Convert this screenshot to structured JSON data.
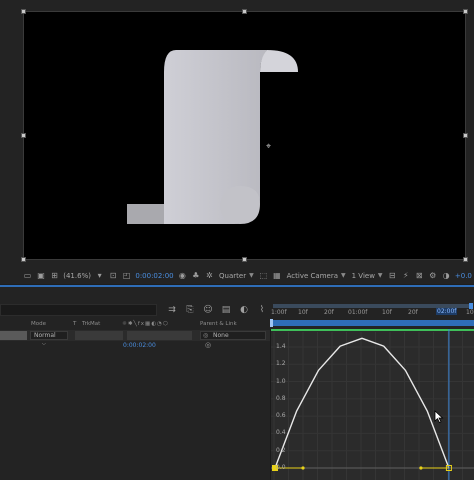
{
  "viewer": {
    "toolbar": {
      "zoom": "(41.6%)",
      "timecode": "0:00:02:00",
      "resolution": "Quarter",
      "camera": "Active Camera",
      "views": "1 View",
      "exposure": "+0.0"
    }
  },
  "timeline": {
    "columns": {
      "mode": "Mode",
      "t": "T",
      "trkmat": "TrkMat",
      "parent": "Parent & Link"
    },
    "layer": {
      "mode": "Normal",
      "parent": "None"
    },
    "property_time": "0:00:02:00",
    "ruler": {
      "ticks": [
        "1:00f",
        "10f",
        "20f",
        "01:00f",
        "10f",
        "20f",
        "02:00f",
        "10"
      ],
      "current_time": "02:00f"
    }
  },
  "chart_data": {
    "type": "line",
    "title": "",
    "xlabel": "",
    "ylabel": "",
    "y_tick_labels": [
      "1.4",
      "1.2",
      "1.0",
      "0.8",
      "0.6",
      "0.4",
      "0.2",
      "0.0"
    ],
    "ylim": [
      0,
      1.55
    ],
    "xlim": [
      0,
      2.3
    ],
    "series": [
      {
        "x": [
          0,
          0.25,
          0.5,
          0.75,
          1.0,
          1.25,
          1.5,
          1.75,
          2.0
        ],
        "values": [
          0,
          0.66,
          1.13,
          1.41,
          1.5,
          1.41,
          1.13,
          0.66,
          0
        ],
        "color": "#e8e8e8"
      }
    ],
    "keyframes": [
      {
        "x": 0,
        "value": 0
      },
      {
        "x": 2.0,
        "value": 0
      }
    ],
    "current_time_x": 2.0,
    "grid": true
  },
  "colors": {
    "accent": "#2e6db8",
    "timecode": "#4a8ee0",
    "keyframe": "#e8d21a",
    "graph_bg": "#2b2b2b",
    "canvas_bg": "#000000"
  }
}
